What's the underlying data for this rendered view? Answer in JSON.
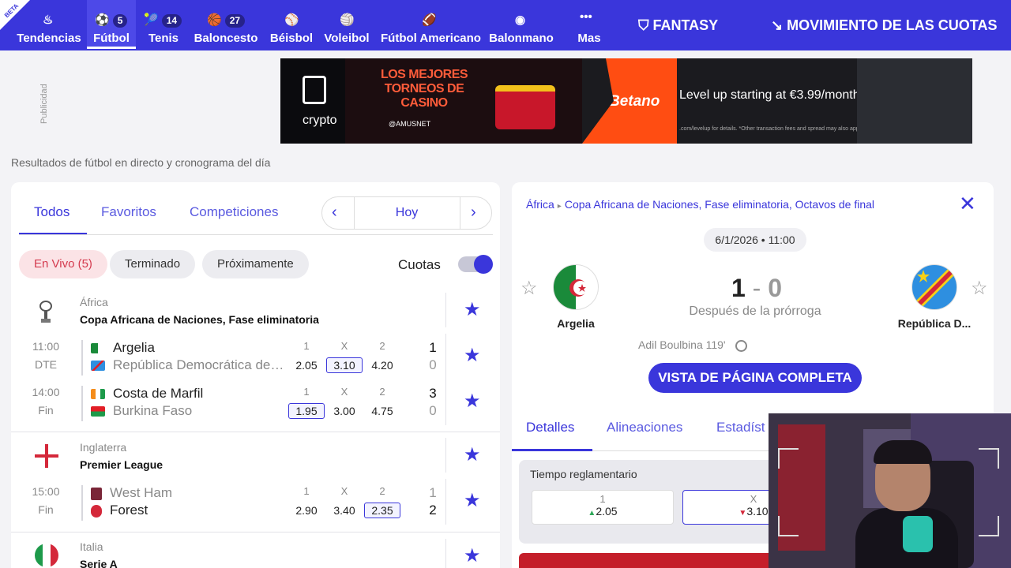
{
  "nav": {
    "beta": "BETA",
    "items": [
      {
        "label": "Tendencias",
        "icon": "flame-icon",
        "glyph": "🔥",
        "count": ""
      },
      {
        "label": "Fútbol",
        "icon": "soccer-ball-icon",
        "glyph": "⚽",
        "count": "5"
      },
      {
        "label": "Tenis",
        "icon": "tennis-icon",
        "glyph": "🎾",
        "count": "14"
      },
      {
        "label": "Baloncesto",
        "icon": "basketball-icon",
        "glyph": "🏀",
        "count": "27"
      },
      {
        "label": "Béisbol",
        "icon": "baseball-bat-icon",
        "glyph": "⚾",
        "count": ""
      },
      {
        "label": "Voleibol",
        "icon": "volleyball-icon",
        "glyph": "🏐",
        "count": ""
      },
      {
        "label": "Fútbol Americano",
        "icon": "american-football-icon",
        "glyph": "🏈",
        "count": ""
      },
      {
        "label": "Balonmano",
        "icon": "handball-icon",
        "glyph": "●",
        "count": ""
      },
      {
        "label": "Mas",
        "icon": "more-dots-icon",
        "glyph": "•••",
        "count": ""
      }
    ],
    "fantasy": "FANTASY",
    "odds_movement": "MOVIMIENTO DE LAS CUOTAS"
  },
  "ad": {
    "label": "Publicidad",
    "crypto": "crypto",
    "casino_title": "LOS MEJORES TORNEOS DE CASINO",
    "casino_brand": "@AMUSNET",
    "betano": "Betano",
    "level_up": "Level up starting at €3.99/month",
    "fine_print": ".com/levelup for details. *Other transaction fees and spread may also apply."
  },
  "page_subtitle": "Resultados de fútbol en directo y cronograma del día",
  "left": {
    "tabs": [
      "Todos",
      "Favoritos",
      "Competiciones"
    ],
    "date_label": "Hoy",
    "chips": {
      "live": "En Vivo (5)",
      "finished": "Terminado",
      "upcoming": "Próximamente"
    },
    "odds_label": "Cuotas",
    "odds_headers": [
      "1",
      "X",
      "2"
    ],
    "competitions": [
      {
        "region": "África",
        "league": "Copa Africana de Naciones, Fase eliminatoria",
        "matches": [
          {
            "time": "11:00",
            "status": "DTE",
            "home": "Argelia",
            "away": "República Democrática del Congo",
            "odds": [
              "2.05",
              "3.10",
              "4.20"
            ],
            "score_home": "1",
            "score_away": "0"
          },
          {
            "time": "14:00",
            "status": "Fin",
            "home": "Costa de Marfil",
            "away": "Burkina Faso",
            "odds": [
              "1.95",
              "3.00",
              "4.75"
            ],
            "score_home": "3",
            "score_away": "0"
          }
        ]
      },
      {
        "region": "Inglaterra",
        "league": "Premier League",
        "matches": [
          {
            "time": "15:00",
            "status": "Fin",
            "home": "West Ham",
            "away": "Forest",
            "odds": [
              "2.90",
              "3.40",
              "2.35"
            ],
            "score_home": "1",
            "score_away": "2"
          }
        ]
      },
      {
        "region": "Italia",
        "league": "Serie A",
        "matches": []
      }
    ]
  },
  "detail": {
    "breadcrumb_region": "África",
    "breadcrumb_competition": "Copa Africana de Naciones, Fase eliminatoria, Octavos de final",
    "datetime": "6/1/2026 • 11:00",
    "home": "Argelia",
    "away": "República D...",
    "score_home": "1",
    "score_sep": "-",
    "score_away": "0",
    "after": "Después de la prórroga",
    "scorer": "Adil Boulbina 119'",
    "full_page": "VISTA DE PÁGINA COMPLETA",
    "tabs": [
      "Detalles",
      "Alineaciones",
      "Estadíst"
    ],
    "regular_time": "Tiempo reglamentario",
    "odds": [
      {
        "key": "1",
        "value": "2.05",
        "dir": "up"
      },
      {
        "key": "X",
        "value": "3.10",
        "dir": "down"
      }
    ]
  }
}
